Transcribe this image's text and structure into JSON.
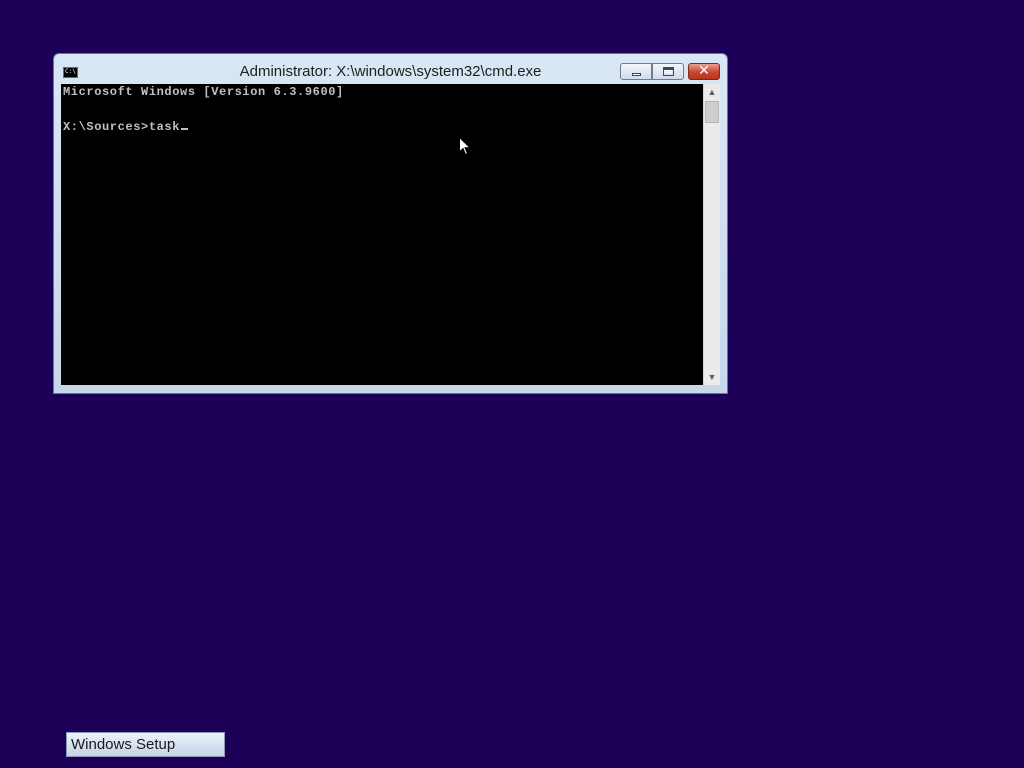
{
  "window": {
    "title": "Administrator: X:\\windows\\system32\\cmd.exe",
    "icon": "cmd-icon",
    "controls": {
      "minimize": "minimize-icon",
      "maximize": "maximize-icon",
      "close_glyph": "✕"
    }
  },
  "console": {
    "line1": "Microsoft Windows [Version 6.3.9600]",
    "line3": "X:\\Sources>task"
  },
  "scrollbar": {
    "up_arrow": "▲",
    "down_arrow": "▼"
  },
  "taskbar": {
    "button_label": "Windows Setup"
  },
  "colors": {
    "desktop": "#1c0057",
    "console_bg": "#000000",
    "console_text": "#c0c0c0",
    "close_button": "#c8452e"
  }
}
